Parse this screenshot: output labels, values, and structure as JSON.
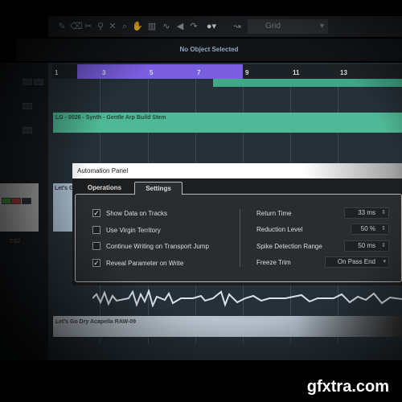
{
  "toolbar": {
    "tools": [
      "pencil",
      "eraser",
      "split",
      "glue",
      "mute",
      "zoom",
      "hand",
      "timewarp",
      "line",
      "speaker",
      "comp"
    ],
    "grid_label": "Grid"
  },
  "info_line": {
    "text": "No Object Selected"
  },
  "ruler": {
    "bars": [
      "1",
      "3",
      "5",
      "7",
      "9",
      "11",
      "13"
    ],
    "loop_color": "#7a5ee0"
  },
  "clips": {
    "synth": "LG - 0026 - Synth - Gentle Arp Build Stem",
    "vocal_short": "Let's G",
    "acapella": "Let's Go Dry Acapella RAW-09"
  },
  "tracklist": {
    "time": "2:02"
  },
  "dialog": {
    "title": "Automation Panel",
    "tabs": [
      {
        "label": "Operations",
        "active": false
      },
      {
        "label": "Settings",
        "active": true
      }
    ],
    "options": [
      {
        "label": "Show Data on Tracks",
        "checked": true
      },
      {
        "label": "Use Virgin Territory",
        "checked": false
      },
      {
        "label": "Continue Writing on Transport Jump",
        "checked": false
      },
      {
        "label": "Reveal Parameter on Write",
        "checked": true
      }
    ],
    "settings": [
      {
        "label": "Return Time",
        "value": "33 ms"
      },
      {
        "label": "Reduction Level",
        "value": "50 %"
      },
      {
        "label": "Spike Detection Range",
        "value": "50 ms"
      },
      {
        "label": "Freeze Trim",
        "value": "On Pass End"
      }
    ]
  },
  "watermark": "gfxtra.com"
}
